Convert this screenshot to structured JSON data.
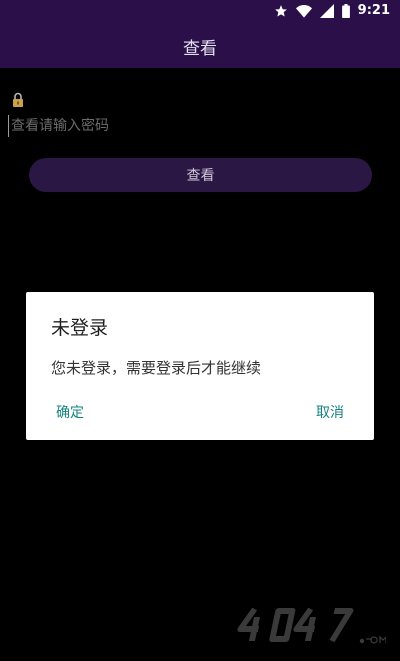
{
  "status_bar": {
    "time": "9:21",
    "icons": [
      "star-icon",
      "wifi-icon",
      "signal-icon",
      "battery-icon"
    ]
  },
  "toolbar": {
    "title": "查看"
  },
  "form": {
    "lock_icon": "lock-icon",
    "password_placeholder": "查看请输入密码",
    "view_button_label": "查看"
  },
  "dialog": {
    "title": "未登录",
    "message": "您未登录，需要登录后才能继续",
    "confirm_label": "确定",
    "cancel_label": "取消"
  },
  "colors": {
    "toolbar_bg": "#2a0f49",
    "button_bg": "#2b1744",
    "dialog_accent": "#16837f"
  }
}
